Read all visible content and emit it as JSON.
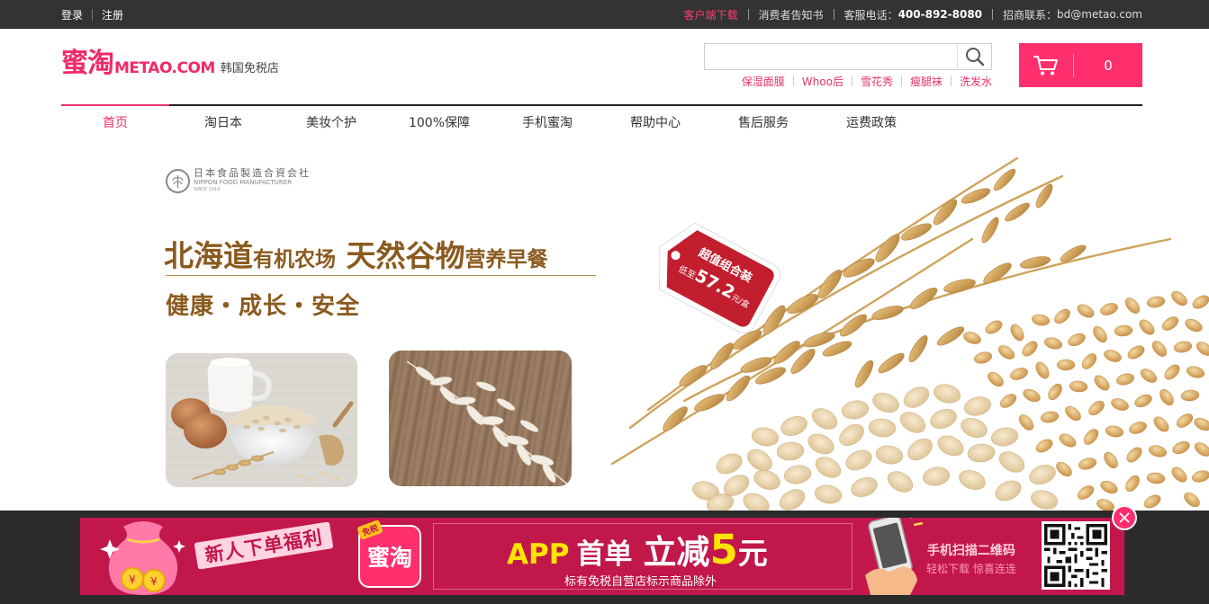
{
  "topbar": {
    "login": "登录",
    "register": "注册",
    "download": "客户端下载",
    "notice": "消费者告知书",
    "service_label": "客服电话：",
    "service_phone": "400-892-8080",
    "biz_label": "招商联系：",
    "biz_email": "bd@metao.com"
  },
  "header": {
    "logo_cn": "蜜淘",
    "logo_en": "METAO.COM",
    "logo_tagline": "韩国免税店",
    "search_placeholder": "",
    "hot_words": [
      "保湿面膜",
      "Whoo后",
      "雪花秀",
      "瘦腿袜",
      "洗发水"
    ],
    "cart_count": "0"
  },
  "nav": {
    "items": [
      {
        "label": "首页",
        "active": true
      },
      {
        "label": "淘日本",
        "active": false
      },
      {
        "label": "美妆个护",
        "active": false
      },
      {
        "label": "100%保障",
        "active": false
      },
      {
        "label": "手机蜜淘",
        "active": false
      },
      {
        "label": "帮助中心",
        "active": false
      },
      {
        "label": "售后服务",
        "active": false
      },
      {
        "label": "运费政策",
        "active": false
      }
    ]
  },
  "banner": {
    "brand_jp": "日本食品製造合資会社",
    "brand_en": "NIPPON FOOD MANUFACTURER",
    "brand_since": "SINCE 1919",
    "headline_1": "北海道",
    "headline_2": "有机农场",
    "headline_3": "天然谷物",
    "headline_4": "营养早餐",
    "subline": "健康・成长・安全",
    "tag_line1": "超值组合装",
    "tag_line2_prefix": "低至",
    "tag_price": "57.2",
    "tag_unit": "元/盒"
  },
  "promo": {
    "slogan": "新人下单福利",
    "app_name": "蜜淘",
    "app_corner": "免税",
    "offer_app": "APP",
    "offer_first": "首单",
    "offer_cut": "立减",
    "offer_amount": "5",
    "offer_unit": "元",
    "note": "标有免税自营店标示商品除外",
    "qr_line1": "手机扫描二维码",
    "qr_line2": "轻松下载  惊喜连连"
  },
  "colors": {
    "brand_pink": "#ff2f6e",
    "topbar_bg": "#333333",
    "promo_bg": "#c2174a",
    "headline_brown": "#8a5a1e"
  },
  "icons": {
    "search": "search-icon",
    "cart": "cart-icon",
    "close": "close-icon"
  }
}
